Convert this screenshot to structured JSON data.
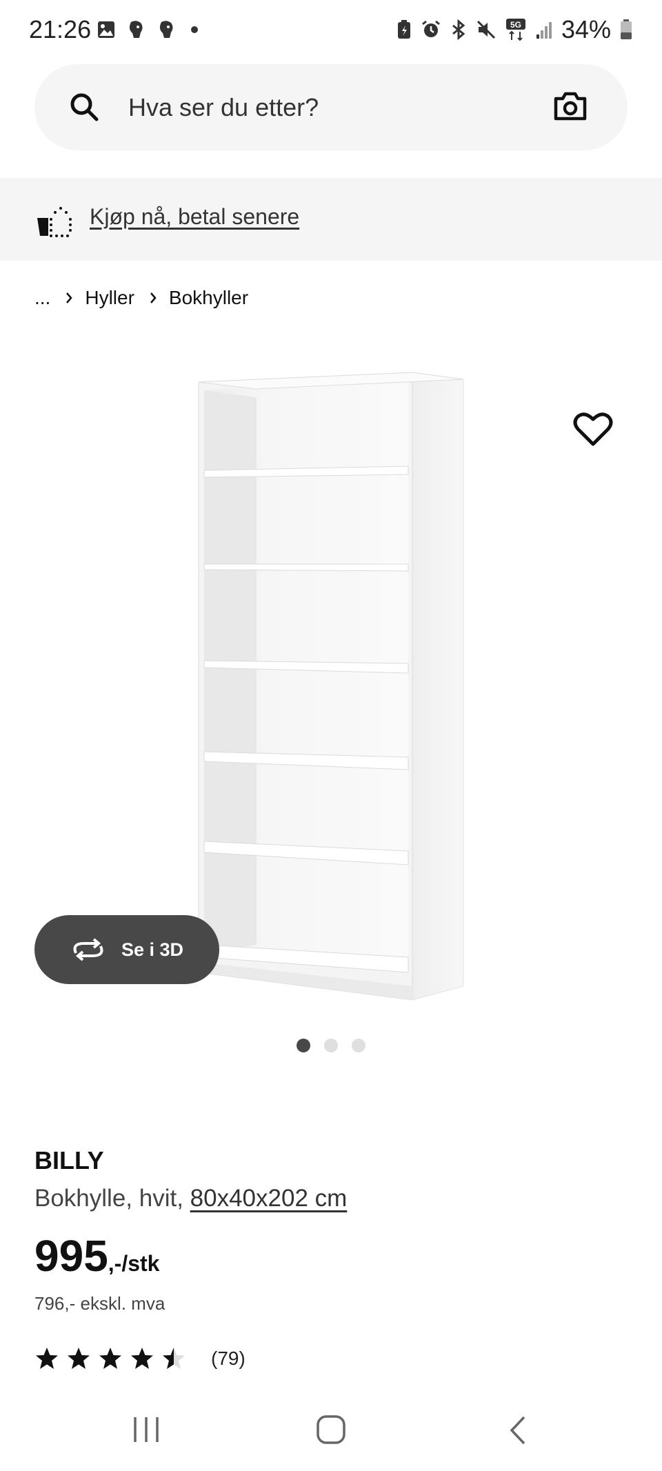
{
  "status_bar": {
    "time": "21:26",
    "battery": "34%",
    "network": "5G"
  },
  "search": {
    "placeholder": "Hva ser du etter?"
  },
  "promo": {
    "link_text": "Kjøp nå, betal senere"
  },
  "breadcrumb": {
    "ellipsis": "...",
    "items": [
      "Hyller",
      "Bokhyller"
    ]
  },
  "gallery": {
    "view_3d_label": "Se i 3D",
    "image_count": 3,
    "active_image": 1
  },
  "product": {
    "name": "BILLY",
    "description_prefix": "Bokhylle, hvit, ",
    "dimensions": "80x40x202 cm",
    "price_integer": "995",
    "price_suffix": ",-/stk",
    "price_excl_vat": "796,- ekskl. mva",
    "rating_value": 4.5,
    "rating_count": "(79)"
  },
  "colors": {
    "surface": "#f5f5f5",
    "button_dark": "#484848",
    "text": "#111111"
  }
}
